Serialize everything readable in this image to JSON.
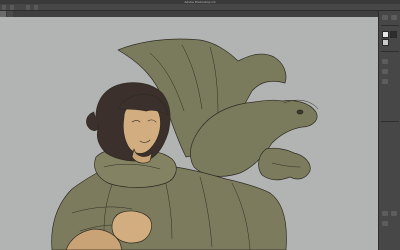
{
  "window": {
    "title": "Adobe Photoshop CC"
  },
  "options_bar": {
    "items": [
      "",
      "",
      "",
      "",
      ""
    ]
  },
  "tabs": [
    {
      "label": "",
      "active": true
    },
    {
      "label": "",
      "active": false
    }
  ],
  "panel": {
    "swatches": [
      "#e8e8e8",
      "#2d2d2d",
      "#c9c9c9"
    ]
  },
  "colors": {
    "canvas_bg": "#b2b3b3",
    "cloak": "#7c7b5e",
    "dragon": "#7a7a5c",
    "hair": "#3b302c",
    "skin": "#d2ad7f",
    "line": "#2f2c22"
  }
}
